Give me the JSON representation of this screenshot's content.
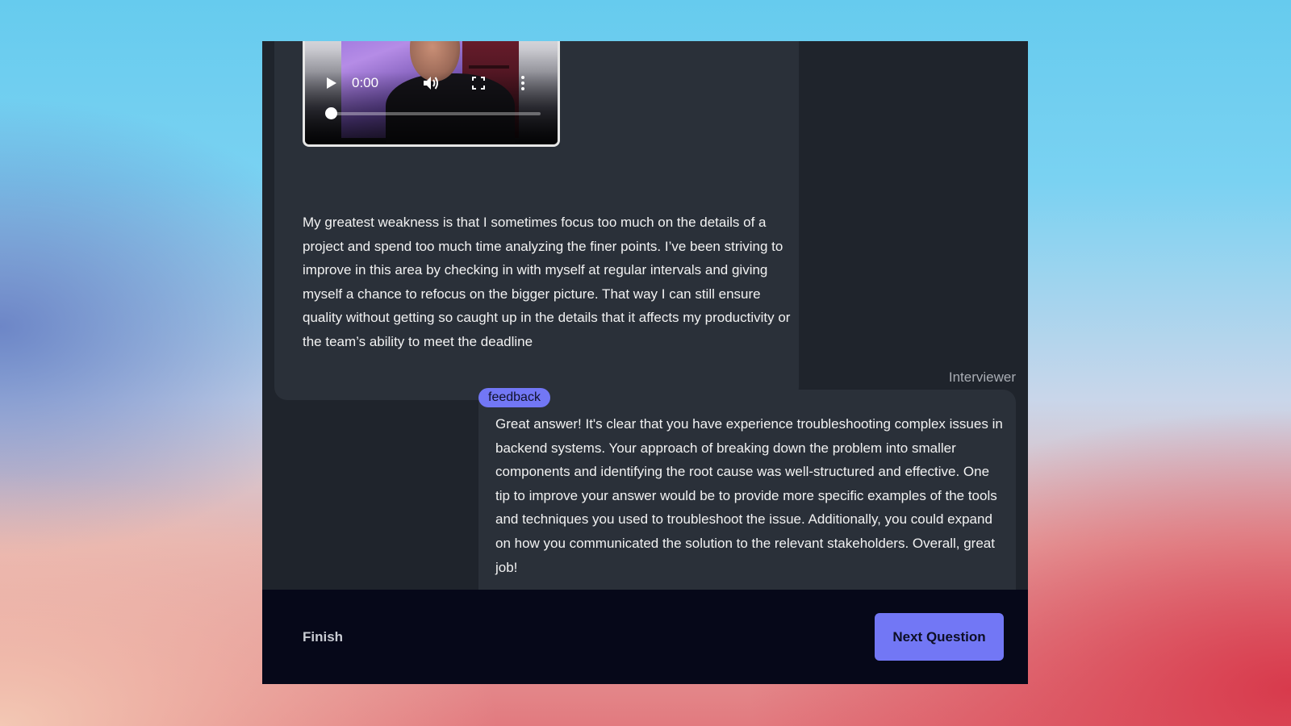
{
  "video": {
    "time": "0:00",
    "progress": 0.0
  },
  "answer": {
    "text": "My greatest weakness is that I sometimes focus too much on the details of a project and spend too much time analyzing the finer points. I’ve been striving to improve in this area by checking in with myself at regular intervals and giving myself a chance to refocus on the bigger picture. That way I can still ensure quality without getting so caught up in the details that it affects my productivity or the team’s ability to meet the deadline"
  },
  "interviewer": {
    "label": "Interviewer",
    "badge": "feedback",
    "feedback_text": "Great answer! It's clear that you have experience troubleshooting complex issues in backend systems. Your approach of breaking down the problem into smaller components and identifying the root cause was well-structured and effective. One tip to improve your answer would be to provide more specific examples of the tools and techniques you used to troubleshoot the issue. Additionally, you could expand on how you communicated the solution to the relevant stakeholders. Overall, great job!"
  },
  "footer": {
    "finish_label": "Finish",
    "next_label": "Next Question"
  },
  "colors": {
    "accent": "#7277f5",
    "panel": "#1f242c",
    "bubble": "#2a3039",
    "footer": "#060819"
  }
}
